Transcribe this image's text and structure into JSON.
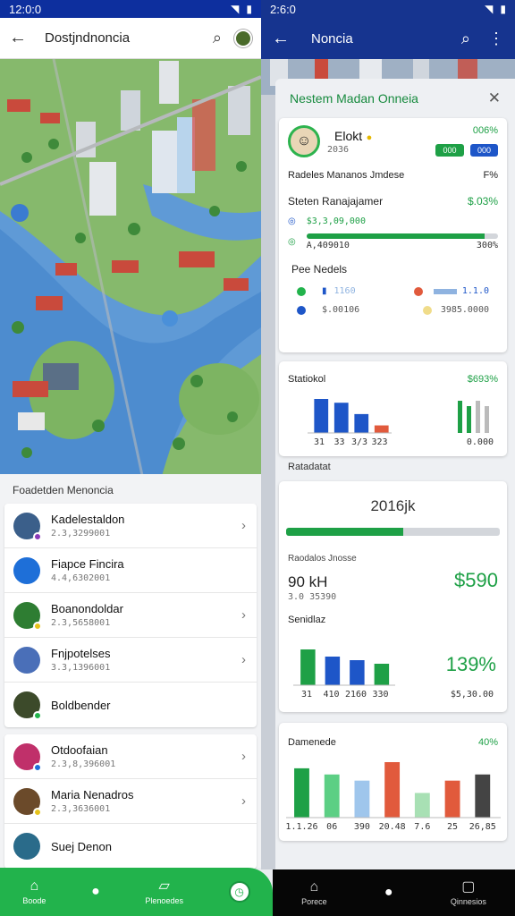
{
  "status_left": {
    "time": "12:0:0"
  },
  "status_right": {
    "time": "2:6:0"
  },
  "left": {
    "title": "Dostjndnoncia",
    "sheet_header": "Foadetden Menoncia",
    "list_group1": [
      {
        "name": "Kadelestaldon",
        "sub": "2.3,3299001",
        "avatar_color": "#3b5f8a",
        "dot": "#8a3ab8",
        "chevron": true
      },
      {
        "name": "Fiapce Fincira",
        "sub": "4.4,6302001",
        "avatar_color": "#1e6fd8",
        "dot": "",
        "chevron": false
      },
      {
        "name": "Boanondoldar",
        "sub": "2.3,5658001",
        "avatar_color": "#2e7d32",
        "dot": "#e6c21b",
        "chevron": true
      },
      {
        "name": "Fnjpotelses",
        "sub": "3.3,1396001",
        "avatar_color": "#4a6fb8",
        "dot": "",
        "chevron": true
      },
      {
        "name": "Boldbender",
        "sub": "",
        "avatar_color": "#3c4a2a",
        "dot": "#22b34c",
        "chevron": false
      }
    ],
    "list_group2": [
      {
        "name": "Otdoofaian",
        "sub": "2.3,8,396001",
        "avatar_color": "#c0306a",
        "dot": "#1e6fd8",
        "chevron": true
      },
      {
        "name": "Maria Nenadros",
        "sub": "2.3,3636001",
        "avatar_color": "#6b4a2a",
        "dot": "#e6c21b",
        "chevron": true
      },
      {
        "name": "Suej Denon",
        "sub": "",
        "avatar_color": "#2a6b8a",
        "dot": "",
        "chevron": false
      }
    ],
    "nav": [
      {
        "label": "Boode",
        "icon": "home-icon"
      },
      {
        "label": "",
        "icon": "circle-icon"
      },
      {
        "label": "Plenoedes",
        "icon": "photo-icon"
      },
      {
        "label": "",
        "icon": "clock-icon"
      }
    ]
  },
  "right": {
    "title": "Noncia",
    "sheet_title": "Nestem Madan Onneia",
    "profile": {
      "name": "Elokt",
      "note": "2036",
      "pct": "006%",
      "pill1": "000",
      "pill2": "000",
      "caption": "Radeles Mananos Jmdese",
      "caption_pct": "F%",
      "stat_title": "Steten Ranajajamer",
      "stat_pct": "$.03%",
      "stat_row1": "$3,3,09,000",
      "stat_row2": "A,409010",
      "stat_row2_pct": "300%",
      "progress": 0.93,
      "section": "Pee Nedels",
      "legend_a": "1160",
      "legend_b": "$.00106",
      "legend_c": "1.1.0",
      "legend_d": "3985.0000"
    },
    "stats_card": {
      "title": "Statiokol",
      "pct": "$693%",
      "x_labels": [
        "31",
        "33",
        "3/3",
        "323"
      ],
      "right_value": "0.000"
    },
    "section_label": "Ratadatat",
    "value_card": {
      "headline": "2016jk",
      "progress": 0.55,
      "label1": "Raodalos Jnosse",
      "value1": "90 kH",
      "sub1": "3.0 35390",
      "green_value": "$590",
      "label2": "Senidlaz",
      "big_pct": "139%",
      "x_labels": [
        "31",
        "410",
        "2160",
        "330"
      ],
      "right_value": "$5,30.00"
    },
    "bottom_card": {
      "title": "Damenede",
      "pct": "40%",
      "x_labels": [
        "1.1.26",
        "06",
        "390",
        "20.48",
        "7.6",
        "25",
        "26,85"
      ]
    },
    "nav": [
      {
        "label": "Porece",
        "icon": "home-icon"
      },
      {
        "label": "",
        "icon": "circle-icon"
      },
      {
        "label": "Qinnesios",
        "icon": "chat-icon"
      }
    ]
  },
  "chart_data": [
    {
      "type": "bar",
      "title": "Statiokol",
      "categories": [
        "31",
        "33",
        "3/3",
        "323"
      ],
      "series": [
        {
          "values": [
            9,
            8,
            5,
            2
          ]
        }
      ]
    },
    {
      "type": "bar",
      "title": "Senidlaz",
      "categories": [
        "31",
        "410",
        "2160",
        "330"
      ],
      "series": [
        {
          "values": [
            10,
            8,
            7,
            6
          ]
        }
      ]
    },
    {
      "type": "bar",
      "title": "Damenede",
      "categories": [
        "1.1.26",
        "06",
        "390",
        "20.48",
        "7.6",
        "25",
        "26,85"
      ],
      "series": [
        {
          "values": [
            16,
            14,
            12,
            18,
            8,
            12,
            14
          ]
        }
      ]
    }
  ]
}
